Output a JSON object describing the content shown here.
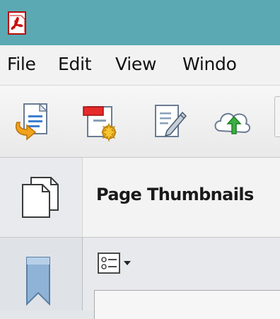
{
  "app": {
    "title_icon": "acrobat-pdf-icon",
    "accent_color": "#5aa9b3"
  },
  "menu": {
    "items": [
      "File",
      "Edit",
      "View",
      "Windo"
    ]
  },
  "toolbar": {
    "icons": [
      "open-file-icon",
      "create-pdf-icon",
      "edit-document-icon",
      "cloud-upload-icon"
    ]
  },
  "panel": {
    "title": "Page Thumbnails",
    "icon": "page-thumbnails-icon"
  },
  "left_rail": {
    "icons": [
      "bookmark-icon"
    ]
  },
  "thumbnail_options": {
    "icon": "thumbnail-options-icon",
    "dropdown_icon": "dropdown-arrow-icon"
  }
}
